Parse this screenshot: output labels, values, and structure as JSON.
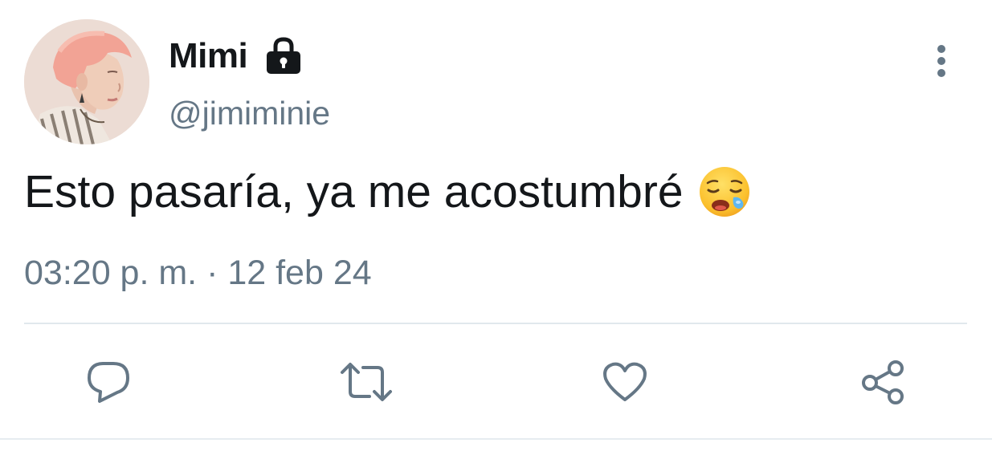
{
  "user": {
    "display_name": "Mimi",
    "handle": "@jimiminie",
    "protected_icon": "lock-icon",
    "avatar_icon": "profile-photo"
  },
  "tweet": {
    "text": "Esto pasaría, ya me acostumbré",
    "emoji": "sleepy-face-emoji",
    "timestamp": "03:20 p. m. · 12 feb 24"
  },
  "actions": [
    {
      "icon": "reply-icon"
    },
    {
      "icon": "retweet-icon"
    },
    {
      "icon": "like-icon"
    },
    {
      "icon": "share-icon"
    }
  ],
  "menu": {
    "icon": "more-vertical-icon"
  },
  "colors": {
    "text_primary": "#14171a",
    "text_secondary": "#657786",
    "icon_gray": "#657786",
    "divider": "#e1e8ed"
  }
}
